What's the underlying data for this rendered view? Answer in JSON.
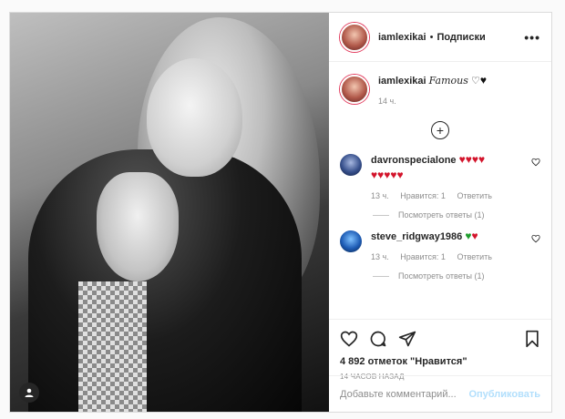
{
  "post": {
    "username": "iamlexikai",
    "follow_label": "Подписки",
    "more_label": "•••"
  },
  "caption": {
    "username": "iamlexikai",
    "text": "Famous",
    "time": "14 ч."
  },
  "comments": [
    {
      "username": "davronspecialone",
      "hearts_line1": "♥♥♥♥",
      "hearts_line2": "♥♥♥♥♥",
      "time": "13 ч.",
      "likes": "Нравится: 1",
      "reply": "Ответить",
      "view_replies": "Посмотреть ответы (1)"
    },
    {
      "username": "steve_ridgway1986",
      "green_heart": "♥",
      "red_heart": "♥",
      "time": "13 ч.",
      "likes": "Нравится: 1",
      "reply": "Ответить",
      "view_replies": "Посмотреть ответы (1)"
    }
  ],
  "likes_text": "4 892 отметок \"Нравится\"",
  "time_ago": "14 ЧАСОВ НАЗАД",
  "add_comment": {
    "placeholder": "Добавьте комментарий...",
    "publish": "Опубликовать"
  },
  "colors": {
    "accent_blue": "#b2dffc",
    "heart_red": "#d3142b",
    "heart_green": "#1f9d2d"
  }
}
